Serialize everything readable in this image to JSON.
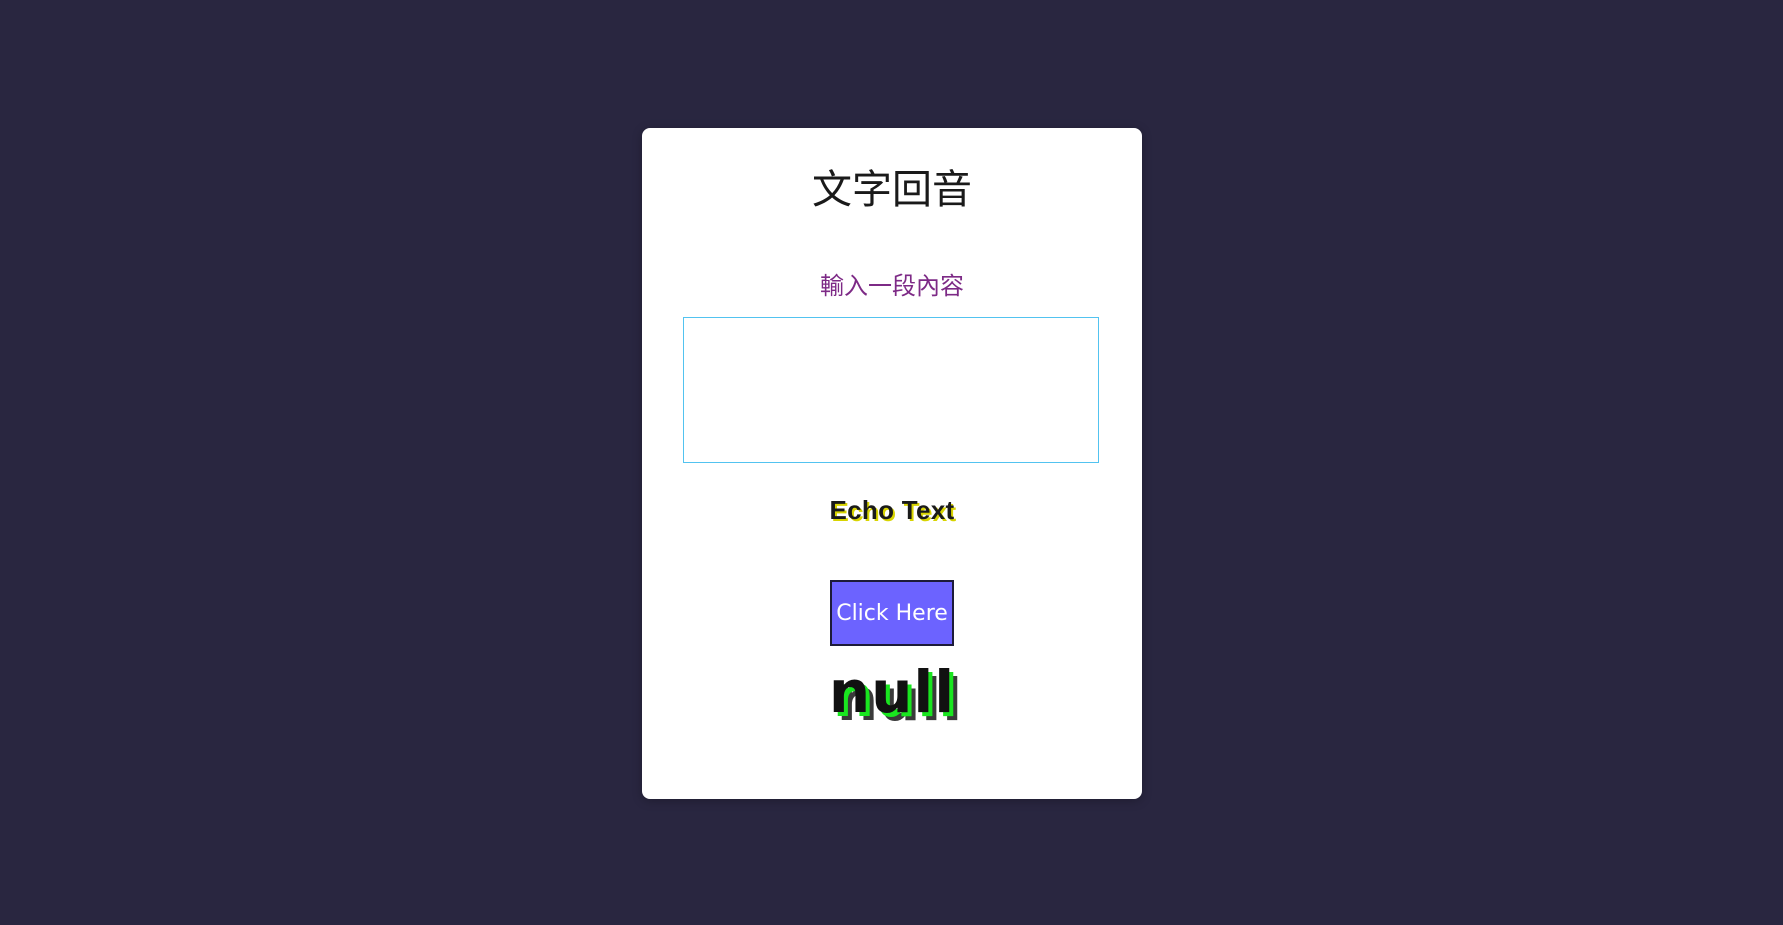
{
  "card": {
    "title": "文字回音",
    "prompt": "輸入一段內容",
    "input": {
      "value": "",
      "placeholder": ""
    },
    "echo_heading": "Echo Text",
    "button_label": "Click Here",
    "result_text": "null"
  },
  "colors": {
    "background": "#292640",
    "card": "#ffffff",
    "prompt_text": "#7d2a86",
    "input_border": "#52c3f0",
    "echo_shadow": "#d8d400",
    "button_bg": "#6c63ff",
    "result_shadow_green": "#19e61f"
  }
}
